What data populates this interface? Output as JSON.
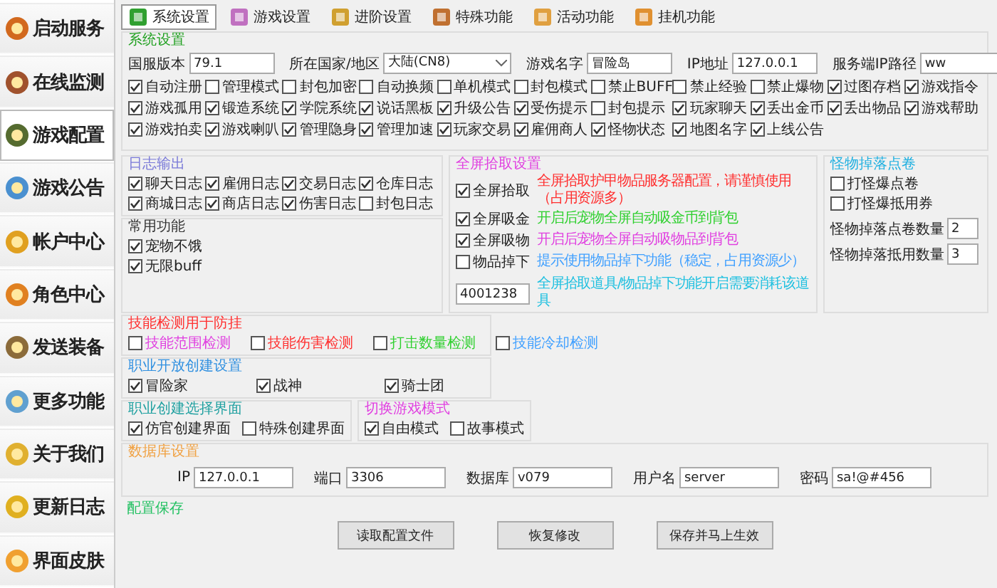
{
  "sidebar": [
    {
      "label": "启动服务",
      "selected": false
    },
    {
      "label": "在线监测",
      "selected": false
    },
    {
      "label": "游戏配置",
      "selected": true
    },
    {
      "label": "游戏公告",
      "selected": false
    },
    {
      "label": "帐户中心",
      "selected": false
    },
    {
      "label": "角色中心",
      "selected": false
    },
    {
      "label": "发送装备",
      "selected": false
    },
    {
      "label": "更多功能",
      "selected": false
    },
    {
      "label": "关于我们",
      "selected": false
    },
    {
      "label": "更新日志",
      "selected": false
    },
    {
      "label": "界面皮肤",
      "selected": false
    }
  ],
  "tabs": [
    {
      "label": "系统设置",
      "selected": true
    },
    {
      "label": "游戏设置",
      "selected": false
    },
    {
      "label": "进阶设置",
      "selected": false
    },
    {
      "label": "特殊功能",
      "selected": false
    },
    {
      "label": "活动功能",
      "selected": false
    },
    {
      "label": "挂机功能",
      "selected": false
    }
  ],
  "system": {
    "title": "系统设置",
    "color": "#20a020",
    "fields": [
      {
        "kind": "input",
        "label": "国服版本",
        "value": "79.1"
      },
      {
        "kind": "select",
        "label": "所在国家/地区",
        "value": "大陆(CN8)"
      },
      {
        "kind": "input",
        "label": "游戏名字",
        "value": "冒险岛"
      },
      {
        "kind": "input",
        "label": "IP地址",
        "value": "127.0.0.1"
      },
      {
        "kind": "input",
        "label": "服务端IP路径",
        "value": "ww"
      }
    ],
    "options": [
      {
        "label": "自动注册",
        "checked": true
      },
      {
        "label": "管理模式",
        "checked": false
      },
      {
        "label": "封包加密",
        "checked": false
      },
      {
        "label": "自动换频",
        "checked": false
      },
      {
        "label": "单机模式",
        "checked": false
      },
      {
        "label": "封包模式",
        "checked": false
      },
      {
        "label": "禁止BUFF",
        "checked": false
      },
      {
        "label": "禁止经验",
        "checked": false
      },
      {
        "label": "禁止爆物",
        "checked": false
      },
      {
        "label": "过图存档",
        "checked": true
      },
      {
        "label": "游戏指令",
        "checked": true
      },
      {
        "label": "游戏孤用",
        "checked": true
      },
      {
        "label": "锻造系统",
        "checked": true
      },
      {
        "label": "学院系统",
        "checked": true
      },
      {
        "label": "说话黑板",
        "checked": true
      },
      {
        "label": "升级公告",
        "checked": true
      },
      {
        "label": "受伤提示",
        "checked": true
      },
      {
        "label": "封包提示",
        "checked": false
      },
      {
        "label": "玩家聊天",
        "checked": true
      },
      {
        "label": "丢出金币",
        "checked": true
      },
      {
        "label": "丢出物品",
        "checked": true
      },
      {
        "label": "游戏帮助",
        "checked": true
      },
      {
        "label": "游戏拍卖",
        "checked": true
      },
      {
        "label": "游戏喇叭",
        "checked": true
      },
      {
        "label": "管理隐身",
        "checked": true
      },
      {
        "label": "管理加速",
        "checked": true
      },
      {
        "label": "玩家交易",
        "checked": true
      },
      {
        "label": "雇佣商人",
        "checked": true
      },
      {
        "label": "怪物状态",
        "checked": true
      },
      {
        "label": "地图名字",
        "checked": true
      },
      {
        "label": "上线公告",
        "checked": true
      }
    ]
  },
  "logs": {
    "title": "日志输出",
    "color": "#7a7ad8",
    "options": [
      {
        "label": "聊天日志",
        "checked": true
      },
      {
        "label": "雇佣日志",
        "checked": true
      },
      {
        "label": "交易日志",
        "checked": true
      },
      {
        "label": "仓库日志",
        "checked": true
      },
      {
        "label": "商城日志",
        "checked": true
      },
      {
        "label": "商店日志",
        "checked": true
      },
      {
        "label": "伤害日志",
        "checked": true
      },
      {
        "label": "封包日志",
        "checked": false
      }
    ]
  },
  "common": {
    "title": "常用功能",
    "color": "#333333",
    "options": [
      {
        "label": "宠物不饿",
        "checked": true
      },
      {
        "label": "无限buff",
        "checked": true
      }
    ]
  },
  "pickup": {
    "title": "全屏拾取设置",
    "color": "#e040e0",
    "rows": [
      {
        "kind": "check",
        "label": "全屏拾取",
        "checked": true,
        "hint": "全屏拾取护甲物品服务器配置，请谨慎使用（占用资源多）",
        "color": "#ff3030"
      },
      {
        "kind": "check",
        "label": "全屏吸金",
        "checked": true,
        "hint": "开启后宠物全屏自动吸金币到背包",
        "color": "#30d030"
      },
      {
        "kind": "check",
        "label": "全屏吸物",
        "checked": true,
        "hint": "开启后宠物全屏自动吸物品到背包",
        "color": "#e040e0"
      },
      {
        "kind": "check",
        "label": "物品掉下",
        "checked": false,
        "hint": "提示使用物品掉下功能（稳定，占用资源少）",
        "color": "#40a0ff"
      },
      {
        "kind": "input",
        "value": "4001238",
        "hint": "全屏拾取道具/物品掉下功能开启需要消耗该道具",
        "color": "#20c0e0"
      }
    ]
  },
  "monster_drop": {
    "title": "怪物掉落点卷",
    "color": "#20b0e0",
    "options": [
      {
        "label": "打怪爆点卷",
        "checked": false
      },
      {
        "label": "打怪爆抵用券",
        "checked": false
      }
    ],
    "fields": [
      {
        "label": "怪物掉落点卷数量",
        "value": "2"
      },
      {
        "label": "怪物掉落抵用数量",
        "value": "3"
      }
    ]
  },
  "skill_check": {
    "title": "技能检测用于防挂",
    "color": "#ff3030",
    "options": [
      {
        "label": "技能范围检测",
        "checked": false,
        "color": "#e040e0"
      },
      {
        "label": "技能伤害检测",
        "checked": false,
        "color": "#ff3030"
      },
      {
        "label": "打击数量检测",
        "checked": false,
        "color": "#30d030"
      },
      {
        "label": "技能冷却检测",
        "checked": false,
        "color": "#40a0ff"
      }
    ]
  },
  "job_open": {
    "title": "职业开放创建设置",
    "color": "#3090e0",
    "options": [
      {
        "label": "冒险家",
        "checked": true
      },
      {
        "label": "战神",
        "checked": true
      },
      {
        "label": "骑士团",
        "checked": true
      }
    ]
  },
  "job_ui": {
    "title": "职业创建选择界面",
    "color": "#20a0a0",
    "options": [
      {
        "label": "仿官创建界面",
        "checked": true
      },
      {
        "label": "特殊创建界面",
        "checked": false
      }
    ]
  },
  "game_mode": {
    "title": "切换游戏模式",
    "color": "#e040e0",
    "options": [
      {
        "label": "自由模式",
        "checked": true
      },
      {
        "label": "故事模式",
        "checked": false
      }
    ]
  },
  "database": {
    "title": "数据库设置",
    "color": "#f0a040",
    "fields": [
      {
        "label": "IP",
        "value": "127.0.0.1"
      },
      {
        "label": "端口",
        "value": "3306"
      },
      {
        "label": "数据库",
        "value": "v079"
      },
      {
        "label": "用户名",
        "value": "server"
      },
      {
        "label": "密码",
        "value": "sa!@#456"
      }
    ]
  },
  "save": {
    "title": "配置保存",
    "color": "#20c060",
    "buttons": [
      "读取配置文件",
      "恢复修改",
      "保存并马上生效"
    ]
  }
}
